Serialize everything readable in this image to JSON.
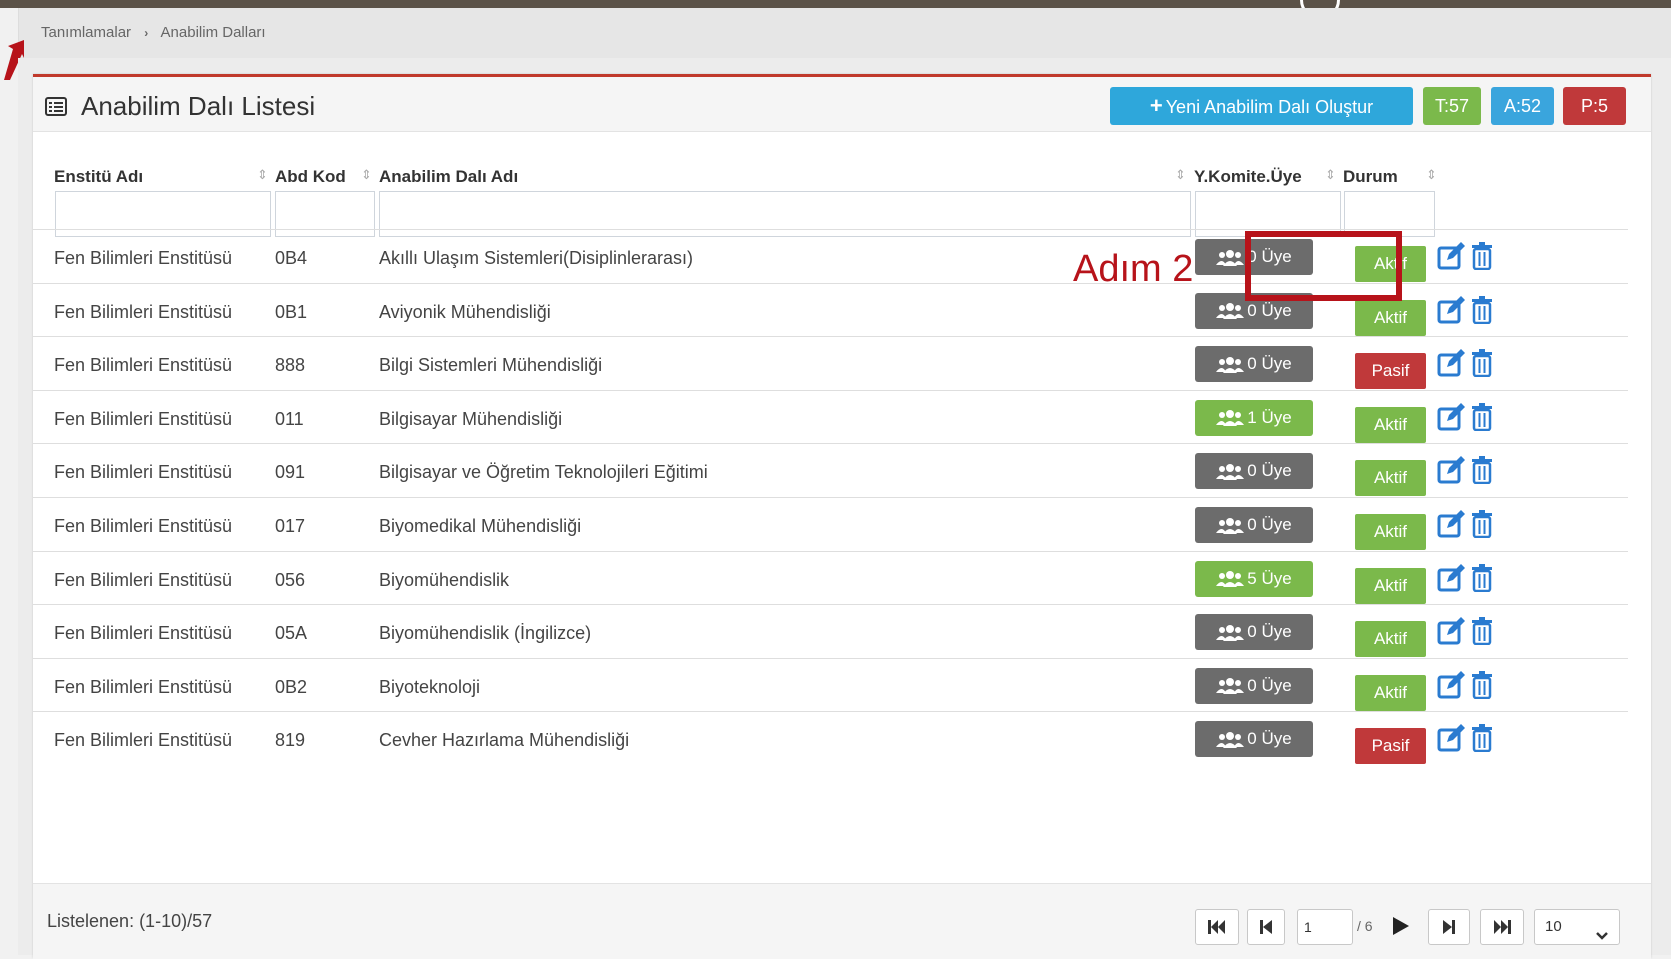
{
  "breadcrumb": {
    "root": "Tanımlamalar",
    "separator": "›",
    "current": "Anabilim Dalları"
  },
  "panel": {
    "title": "Anabilim Dalı Listesi",
    "new_button": "Yeni Anabilim Dalı Oluştur",
    "badges": {
      "total": "T:57",
      "active": "A:52",
      "passive": "P:5"
    }
  },
  "table": {
    "headers": {
      "institute": "Enstitü Adı",
      "code": "Abd Kod",
      "name": "Anabilim Dalı Adı",
      "committee": "Y.Komite.Üye",
      "status": "Durum"
    },
    "rows": [
      {
        "institute": "Fen Bilimleri Enstitüsü",
        "code": "0B4",
        "name": "Akıllı Ulaşım Sistemleri(Disiplinlerarası)",
        "members": "0 Üye",
        "member_color": "gray",
        "status": "Aktif"
      },
      {
        "institute": "Fen Bilimleri Enstitüsü",
        "code": "0B1",
        "name": "Aviyonik Mühendisliği",
        "members": "0 Üye",
        "member_color": "gray",
        "status": "Aktif"
      },
      {
        "institute": "Fen Bilimleri Enstitüsü",
        "code": "888",
        "name": "Bilgi Sistemleri Mühendisliği",
        "members": "0 Üye",
        "member_color": "gray",
        "status": "Pasif"
      },
      {
        "institute": "Fen Bilimleri Enstitüsü",
        "code": "011",
        "name": "Bilgisayar Mühendisliği",
        "members": "1 Üye",
        "member_color": "green",
        "status": "Aktif"
      },
      {
        "institute": "Fen Bilimleri Enstitüsü",
        "code": "091",
        "name": "Bilgisayar ve Öğretim Teknolojileri Eğitimi",
        "members": "0 Üye",
        "member_color": "gray",
        "status": "Aktif"
      },
      {
        "institute": "Fen Bilimleri Enstitüsü",
        "code": "017",
        "name": "Biyomedikal Mühendisliği",
        "members": "0 Üye",
        "member_color": "gray",
        "status": "Aktif"
      },
      {
        "institute": "Fen Bilimleri Enstitüsü",
        "code": "056",
        "name": "Biyomühendislik",
        "members": "5 Üye",
        "member_color": "green",
        "status": "Aktif"
      },
      {
        "institute": "Fen Bilimleri Enstitüsü",
        "code": "05A",
        "name": "Biyomühendislik (İngilizce)",
        "members": "0 Üye",
        "member_color": "gray",
        "status": "Aktif"
      },
      {
        "institute": "Fen Bilimleri Enstitüsü",
        "code": "0B2",
        "name": "Biyoteknoloji",
        "members": "0 Üye",
        "member_color": "gray",
        "status": "Aktif"
      },
      {
        "institute": "Fen Bilimleri Enstitüsü",
        "code": "819",
        "name": "Cevher Hazırlama Mühendisliği",
        "members": "0 Üye",
        "member_color": "gray",
        "status": "Pasif"
      }
    ]
  },
  "annotation": {
    "label": "Adım 2"
  },
  "footer": {
    "listed": "Listelenen: (1-10)/57",
    "page_current": "1",
    "page_total": "/ 6",
    "page_size": "10"
  },
  "colors": {
    "accent_red": "#c0393a",
    "green": "#7bb94b",
    "blue": "#2ea7db",
    "gray_badge": "#6c6c6c",
    "annotation": "#b7131a"
  }
}
